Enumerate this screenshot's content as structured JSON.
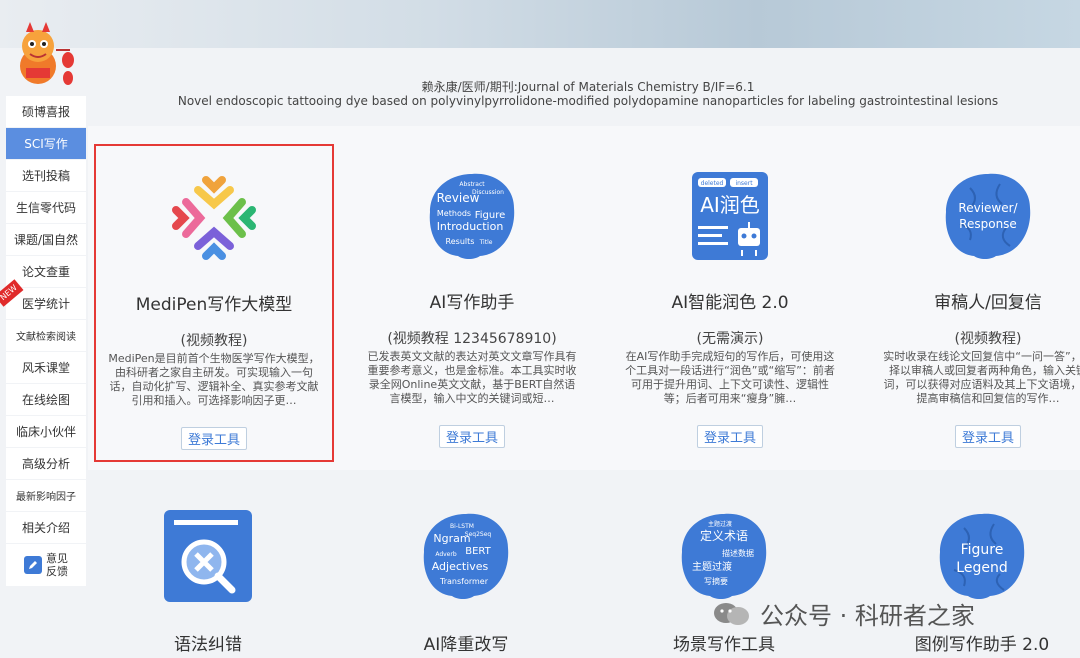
{
  "sidebar": {
    "items": [
      {
        "label": "硕博喜报"
      },
      {
        "label": "SCI写作"
      },
      {
        "label": "选刊投稿"
      },
      {
        "label": "生信零代码"
      },
      {
        "label": "课题/国自然"
      },
      {
        "label": "论文查重"
      },
      {
        "label": "医学统计"
      },
      {
        "label": "文献检索阅读"
      },
      {
        "label": "风禾课堂"
      },
      {
        "label": "在线绘图"
      },
      {
        "label": "临床小伙伴"
      },
      {
        "label": "高级分析"
      },
      {
        "label": "最新影响因子"
      },
      {
        "label": "相关介绍"
      }
    ],
    "active_index": 1,
    "new_badge": "NEW",
    "feedback": "意见\n反馈"
  },
  "paper": {
    "line1": "赖永康/医师/期刊:Journal of Materials Chemistry B/IF=6.1",
    "line2": "Novel endoscopic tattooing dye based on polyvinylpyrrolidone-modified polydopamine nanoparticles for labeling gastrointestinal lesions"
  },
  "cards": [
    {
      "title": "MediPen写作大模型",
      "sub": "(视频教程)",
      "desc": "MediPen是目前首个生物医学写作大模型，由科研者之家自主研发。可实现输入一句话，自动化扩写、逻辑补全、真实参考文献引用和插入。可选择影响因子更…",
      "button": "登录工具"
    },
    {
      "title": "AI写作助手",
      "sub": "(视频教程 12345678910)",
      "desc": "已发表英文文献的表达对英文文章写作具有重要参考意义，也是金标准。本工具实时收录全网Online英文文献，基于BERT自然语言模型，输入中文的关键词或短…",
      "button": "登录工具",
      "icon_words": [
        "Abstract",
        "Discussion",
        "Review",
        "Methods",
        "Figure",
        "Introduction",
        "Results",
        "Title"
      ]
    },
    {
      "title": "AI智能润色 2.0",
      "sub": "(无需演示)",
      "desc": "在AI写作助手完成短句的写作后，可使用这个工具对一段话进行“润色”或“缩写”：前者可用于提升用词、上下文可读性、逻辑性等；后者可用来“瘦身”臃…",
      "button": "登录工具",
      "icon_text": "AI润色",
      "icon_tags": [
        "deleted",
        "insert"
      ]
    },
    {
      "title": "审稿人/回复信",
      "sub": "(视频教程)",
      "desc": "实时收录在线论文回复信中“一问一答”，选择以审稿人或回复者两种角色，输入关键词，可以获得对应语料及其上下文语境，可提高审稿信和回复信的写作…",
      "button": "登录工具",
      "icon_text": "Reviewer/\nResponse"
    }
  ],
  "cards2": [
    {
      "title": "语法纠错"
    },
    {
      "title": "AI降重改写",
      "icon_words": [
        "Bi-LSTM",
        "Seq2Seq",
        "Ngram",
        "BERT",
        "Adjectives",
        "Adverb",
        "Transformer"
      ]
    },
    {
      "title": "场景写作工具",
      "icon_words": [
        "主题过渡",
        "定义术语",
        "描述数据",
        "主题过渡",
        "写摘要"
      ]
    },
    {
      "title": "图例写作助手 2.0",
      "icon_text": "Figure\nLegend"
    }
  ],
  "watermark": "公众号 · 科研者之家",
  "colors": {
    "accent": "#5b8ee0",
    "icon_blue": "#3e7ad6",
    "selected_border": "#e53935"
  }
}
